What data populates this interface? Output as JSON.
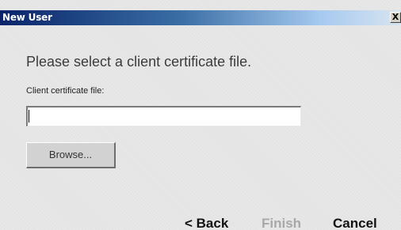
{
  "window": {
    "title": "New User",
    "close_glyph": "X"
  },
  "main": {
    "instruction": "Please select a client certificate file.",
    "field_label": "Client certificate file:",
    "field_value": "",
    "browse_label": "Browse..."
  },
  "footer": {
    "back_label": "< Back",
    "finish_label": "Finish",
    "cancel_label": "Cancel",
    "finish_enabled": false
  },
  "colors": {
    "titlebar_start": "#0a246a",
    "titlebar_end": "#d8e4f0",
    "disabled_text": "#a8a8a8"
  }
}
